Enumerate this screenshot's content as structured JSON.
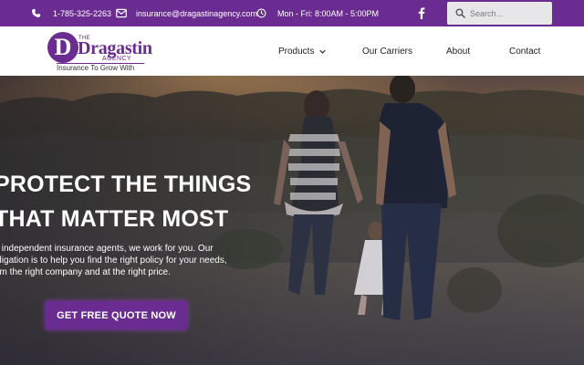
{
  "topbar": {
    "background": "#6a2c91",
    "phone": "1-785-325-2263",
    "email": "insurance@dragastinagency.com",
    "hours": "Mon - Fri: 8:00AM - 5:00PM",
    "icons": [
      "phone-icon",
      "mail-icon",
      "clock-icon",
      "facebook-icon"
    ],
    "search_placeholder": "Search..."
  },
  "logo": {
    "letter": "D",
    "the": "THE",
    "name": "Dragastin",
    "agency": "AGENCY",
    "tagline": "Insurance To Grow With"
  },
  "nav": {
    "items": [
      {
        "label": "Products",
        "has_dropdown": true
      },
      {
        "label": "Our Carriers"
      },
      {
        "label": "About"
      },
      {
        "label": "Contact"
      }
    ]
  },
  "hero": {
    "title_line1": "PROTECT THE THINGS",
    "title_line2": "THAT MATTER MOST",
    "body_line1": "s independent insurance agents, we work for you. Our",
    "body_line2": "bligation is to help you find the right policy for your needs,",
    "body_line3": "om the right company and at the right price.",
    "cta": "GET FREE QUOTE NOW",
    "accent": "#6a2c91"
  }
}
